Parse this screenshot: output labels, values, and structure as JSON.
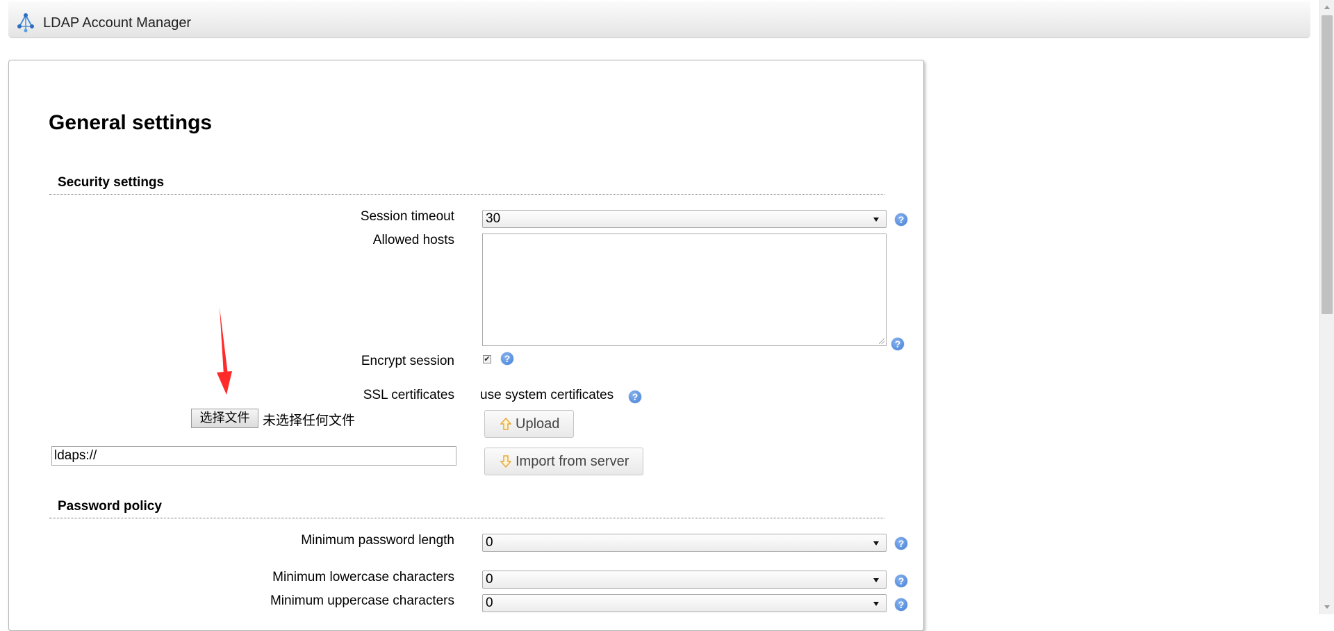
{
  "header": {
    "app_title": "LDAP Account Manager"
  },
  "page": {
    "title": "General settings"
  },
  "security": {
    "section_title": "Security settings",
    "session_timeout": {
      "label": "Session timeout",
      "value": "30"
    },
    "allowed_hosts": {
      "label": "Allowed hosts",
      "value": ""
    },
    "encrypt_session": {
      "label": "Encrypt session",
      "checked": true
    },
    "ssl_certificates": {
      "label": "SSL certificates",
      "value": "use system certificates"
    },
    "file_input": {
      "button_label": "选择文件",
      "status": "未选择任何文件"
    },
    "ldaps_input": {
      "value": "ldaps://"
    },
    "upload_button": "Upload",
    "import_button": "Import from server"
  },
  "password_policy": {
    "section_title": "Password policy",
    "min_length": {
      "label": "Minimum password length",
      "value": "0"
    },
    "min_lowercase": {
      "label": "Minimum lowercase characters",
      "value": "0"
    },
    "min_uppercase": {
      "label": "Minimum uppercase characters",
      "value": "0"
    }
  },
  "icons": {
    "logo": "lam-network-logo-icon",
    "help": "help-question-icon",
    "upload": "arrow-up-icon",
    "import": "arrow-down-icon",
    "annotation": "red-arrow-annotation"
  },
  "colors": {
    "help_icon": "#3f7dd6",
    "annotation_arrow": "#ff2a2a",
    "upload_icon": "#e8a838"
  }
}
